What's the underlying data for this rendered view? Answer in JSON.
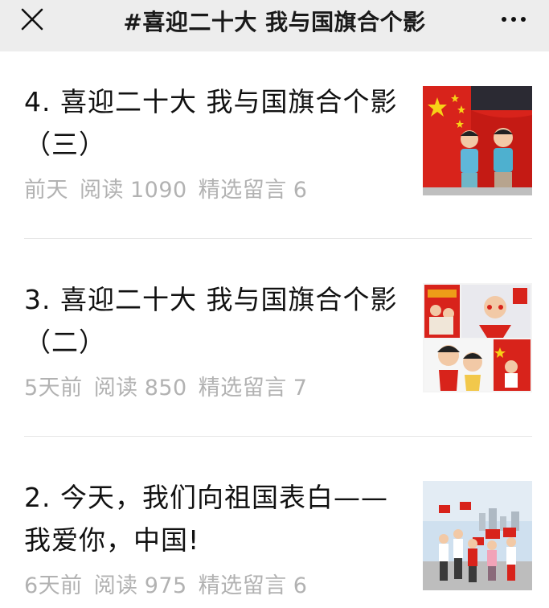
{
  "header": {
    "title": "#喜迎二十大 我与国旗合个影",
    "close_icon": "close-icon",
    "more_icon": "more-icon"
  },
  "articles": [
    {
      "title": "4. 喜迎二十大 我与国旗合个影（三）",
      "date": "前天",
      "reads_label": "阅读",
      "reads": "1090",
      "comments_label": "精选留言",
      "comments": "6"
    },
    {
      "title": "3. 喜迎二十大 我与国旗合个影（二）",
      "date": "5天前",
      "reads_label": "阅读",
      "reads": "850",
      "comments_label": "精选留言",
      "comments": "7"
    },
    {
      "title": "2. 今天，我们向祖国表白——我爱你，中国!",
      "date": "6天前",
      "reads_label": "阅读",
      "reads": "975",
      "comments_label": "精选留言",
      "comments": "6"
    }
  ],
  "colors": {
    "flag_red": "#d8231b",
    "star_yellow": "#f7d117",
    "meta_gray": "#b2b2b2"
  }
}
